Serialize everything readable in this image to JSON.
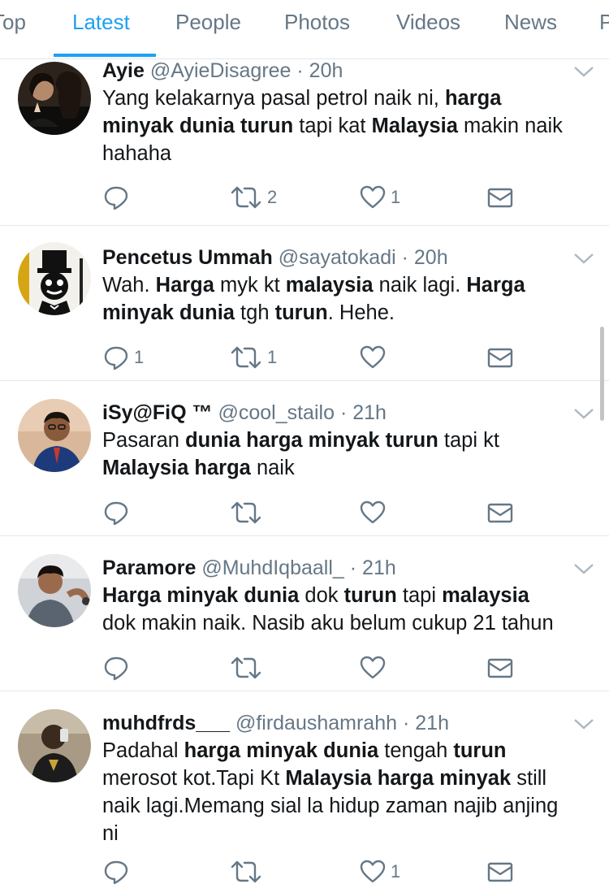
{
  "tabs": [
    {
      "label": "Top"
    },
    {
      "label": "Latest"
    },
    {
      "label": "People"
    },
    {
      "label": "Photos"
    },
    {
      "label": "Videos"
    },
    {
      "label": "News"
    },
    {
      "label": "P"
    }
  ],
  "accent": "#1da1f2",
  "tweets": [
    {
      "name": "Ayie",
      "handle": "@AyieDisagree",
      "time": "· 20h",
      "body": [
        {
          "t": "Yang kelakarnya pasal petrol naik ni, "
        },
        {
          "b": "harga"
        },
        {
          "t": "\n"
        },
        {
          "b": "minyak dunia turun"
        },
        {
          "t": " tapi kat "
        },
        {
          "b": "Malaysia"
        },
        {
          "t": " makin naik\nhahaha"
        }
      ],
      "reply_count": "",
      "retweet_count": "2",
      "like_count": "1"
    },
    {
      "name": "Pencetus Ummah",
      "handle": "@sayatokadi",
      "time": "· 20h",
      "body": [
        {
          "t": "Wah. "
        },
        {
          "b": "Harga"
        },
        {
          "t": " myk kt "
        },
        {
          "b": "malaysia"
        },
        {
          "t": " naik lagi. "
        },
        {
          "b": "Harga"
        },
        {
          "t": "\n"
        },
        {
          "b": "minyak dunia"
        },
        {
          "t": " tgh "
        },
        {
          "b": "turun"
        },
        {
          "t": ". Hehe."
        }
      ],
      "reply_count": "1",
      "retweet_count": "1",
      "like_count": ""
    },
    {
      "name": "iSy@FiQ ™",
      "handle": "@cool_stailo",
      "time": "· 21h",
      "body": [
        {
          "t": "Pasaran "
        },
        {
          "b": "dunia harga minyak turun"
        },
        {
          "t": " tapi kt\n"
        },
        {
          "b": "Malaysia harga"
        },
        {
          "t": " naik"
        }
      ],
      "reply_count": "",
      "retweet_count": "",
      "like_count": ""
    },
    {
      "name": "Paramore",
      "handle": "@MuhdIqbaall_",
      "time": "· 21h",
      "body": [
        {
          "b": "Harga minyak dunia"
        },
        {
          "t": " dok "
        },
        {
          "b": "turun"
        },
        {
          "t": " tapi "
        },
        {
          "b": "malaysia"
        },
        {
          "t": "\ndok makin naik. Nasib aku belum cukup 21 tahun"
        }
      ],
      "reply_count": "",
      "retweet_count": "",
      "like_count": ""
    },
    {
      "name": "muhdfrds___",
      "handle": "@firdaushamrahh",
      "time": "· 21h",
      "body": [
        {
          "t": "Padahal "
        },
        {
          "b": "harga minyak dunia"
        },
        {
          "t": " tengah "
        },
        {
          "b": "turun"
        },
        {
          "t": "\nmerosot kot.Tapi Kt "
        },
        {
          "b": "Malaysia harga minyak"
        },
        {
          "t": " still\nnaik lagi.Memang sial la hidup zaman najib anjing\nni"
        }
      ],
      "reply_count": "",
      "retweet_count": "",
      "like_count": "1"
    }
  ],
  "icons": {
    "reply": "reply-icon",
    "retweet": "retweet-icon",
    "like": "heart-icon",
    "dm": "envelope-icon",
    "menu": "chevron-down-icon"
  }
}
